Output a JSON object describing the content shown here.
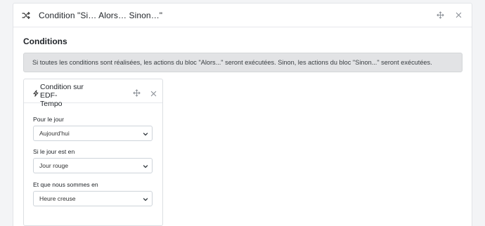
{
  "outer_block": {
    "title": "Condition \"Si… Alors… Sinon…\""
  },
  "section": {
    "title": "Conditions"
  },
  "info_message": "Si toutes les conditions sont réalisées, les actions du bloc \"Alors...\" seront exécutées. Sinon, les actions du bloc \"Sinon...\" seront exécutées.",
  "condition_card": {
    "title_line1": "Condition sur EDF-",
    "title_line2": "Tempo",
    "fields": [
      {
        "label": "Pour le jour",
        "value": "Aujourd'hui"
      },
      {
        "label": "Si le jour est en",
        "value": "Jour rouge"
      },
      {
        "label": "Et que nous sommes en",
        "value": "Heure creuse"
      }
    ]
  },
  "icons": {
    "outer": [
      "shuffle-icon",
      "move-icon",
      "close-icon"
    ],
    "card": [
      "bolt-icon",
      "move-icon",
      "close-icon"
    ],
    "select": "chevron-down-icon"
  },
  "colors": {
    "page_background": "#f3f4f6",
    "info_background": "#e2e3e5",
    "border": "#dcdfe3"
  }
}
